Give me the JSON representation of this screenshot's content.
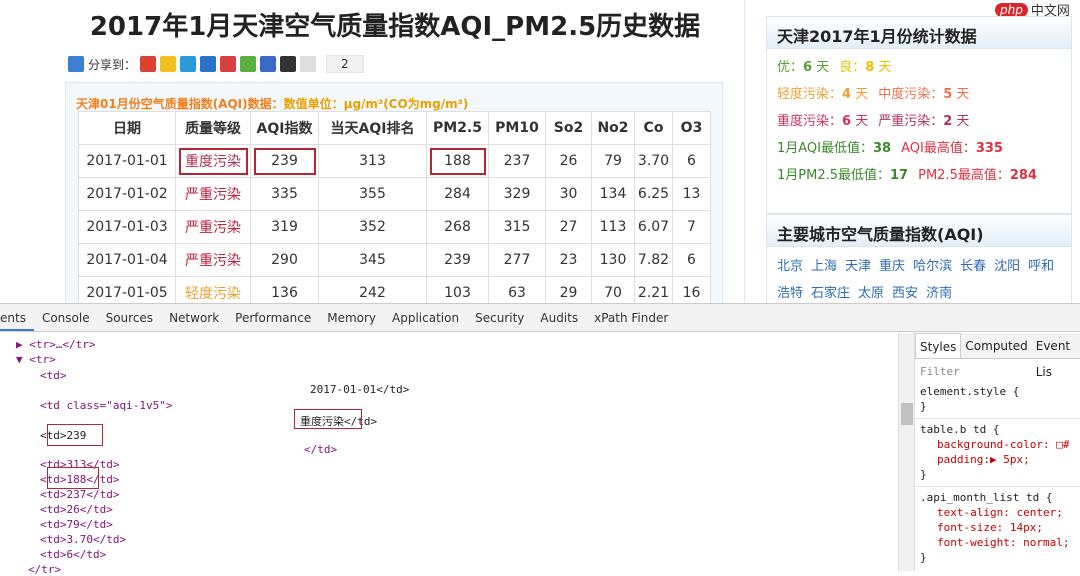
{
  "page": {
    "title": "2017年1月天津空气质量指数AQI_PM2.5历史数据",
    "share": {
      "label": "分享到：",
      "count": "2"
    },
    "unit_note": "天津01月份空气质量指数(AQI)数据：",
    "unit_value": "数值单位：μg/m³(CO为mg/m³)",
    "table": {
      "headers": [
        "日期",
        "质量等级",
        "AQI指数",
        "当天AQI排名",
        "PM2.5",
        "PM10",
        "So2",
        "No2",
        "Co",
        "O3"
      ],
      "rows": [
        [
          "2017-01-01",
          "重度污染",
          "239",
          "313",
          "188",
          "237",
          "26",
          "79",
          "3.70",
          "6"
        ],
        [
          "2017-01-02",
          "严重污染",
          "335",
          "355",
          "284",
          "329",
          "30",
          "134",
          "6.25",
          "13"
        ],
        [
          "2017-01-03",
          "严重污染",
          "319",
          "352",
          "268",
          "315",
          "27",
          "113",
          "6.07",
          "7"
        ],
        [
          "2017-01-04",
          "严重污染",
          "290",
          "345",
          "239",
          "277",
          "23",
          "130",
          "7.82",
          "6"
        ],
        [
          "2017-01-05",
          "轻度污染",
          "136",
          "242",
          "103",
          "63",
          "29",
          "70",
          "2.21",
          "16"
        ]
      ]
    }
  },
  "sidebar": {
    "stats_title": "天津2017年1月份统计数据",
    "stats": [
      [
        {
          "k": "优：",
          "v": "6",
          "u": "天",
          "c": "#5a9e2f"
        },
        {
          "k": "良：",
          "v": "8",
          "u": "天",
          "c": "#e6c200"
        }
      ],
      [
        {
          "k": "轻度污染：",
          "v": "4",
          "u": "天",
          "c": "#f0a030"
        },
        {
          "k": "中度污染：",
          "v": "5",
          "u": "天",
          "c": "#f07050"
        }
      ],
      [
        {
          "k": "重度污染：",
          "v": "6",
          "u": "天",
          "c": "#d9305a"
        },
        {
          "k": "严重污染：",
          "v": "2",
          "u": "天",
          "c": "#b03060"
        }
      ],
      [
        {
          "k": "1月AQI最低值：",
          "v": "38",
          "u": "",
          "c": "#3a8a2a"
        },
        {
          "k": "AQI最高值：",
          "v": "335",
          "u": "",
          "c": "#e03040"
        }
      ],
      [
        {
          "k": "1月PM2.5最低值：",
          "v": "17",
          "u": "",
          "c": "#3a8a2a"
        },
        {
          "k": "PM2.5最高值：",
          "v": "284",
          "u": "",
          "c": "#e03040"
        }
      ]
    ],
    "cities_title": "主要城市空气质量指数(AQI)",
    "cities": [
      "北京",
      "上海",
      "天津",
      "重庆",
      "哈尔滨",
      "长春",
      "沈阳",
      "呼和浩特",
      "石家庄",
      "太原",
      "西安",
      "济南"
    ]
  },
  "logo": {
    "text": "php中文网"
  },
  "devtools": {
    "tabs": [
      "ents",
      "Console",
      "Sources",
      "Network",
      "Performance",
      "Memory",
      "Application",
      "Security",
      "Audits",
      "xPath Finder"
    ],
    "dom": [
      "▶ <tr>…</tr>",
      "▼ <tr>",
      "<td>",
      "2017-01-01</td>",
      "<td class=\"aqi-1v5\">",
      "重度污染</td>",
      "<td>239",
      "</td>",
      "<td>313</td>",
      "<td>188</td>",
      "<td>237</td>",
      "<td>26</td>",
      "<td>79</td>",
      "<td>3.70</td>",
      "<td>6</td>",
      "</tr>"
    ],
    "style_tabs": [
      "Styles",
      "Computed",
      "Event Lis"
    ],
    "filter": "Filter",
    "rules": [
      {
        "sel": "element.style {",
        "props": []
      },
      {
        "sel": "table.b td {",
        "props": [
          "background-color: □#",
          "padding:▶ 5px;"
        ]
      },
      {
        "sel": ".api_month_list td {",
        "props": [
          "text-align: center;",
          "font-size: 14px;",
          "font-weight: normal;"
        ]
      }
    ],
    "close": "}"
  }
}
